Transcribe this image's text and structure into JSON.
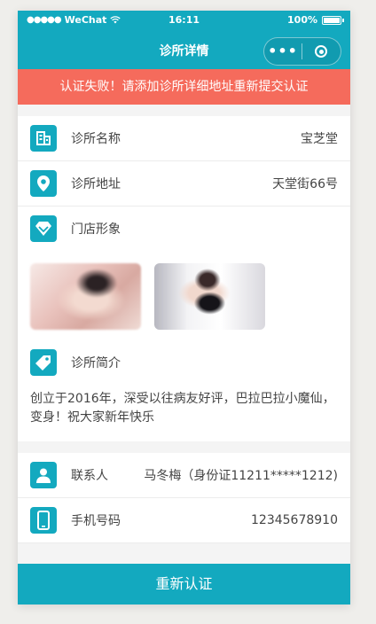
{
  "status_bar": {
    "carrier": "WeChat",
    "time": "16:11",
    "battery": "100%"
  },
  "nav": {
    "title": "诊所详情",
    "more_label": "•••"
  },
  "alert": {
    "text": "认证失败！请添加诊所详细地址重新提交认证"
  },
  "details": {
    "name_label": "诊所名称",
    "name_value": "宝芝堂",
    "address_label": "诊所地址",
    "address_value": "天堂街66号",
    "images_label": "门店形象",
    "intro_label": "诊所简介",
    "intro_text": "创立于2016年，深受以往病友好评，巴拉巴拉小魔仙，变身！祝大家新年快乐"
  },
  "contact": {
    "contact_label": "联系人",
    "contact_value": "马冬梅（身份证11211*****1212)",
    "phone_label": "手机号码",
    "phone_value": "12345678910"
  },
  "footer": {
    "button_label": "重新认证"
  },
  "colors": {
    "primary": "#13a9bf",
    "alert": "#f56b5c"
  }
}
